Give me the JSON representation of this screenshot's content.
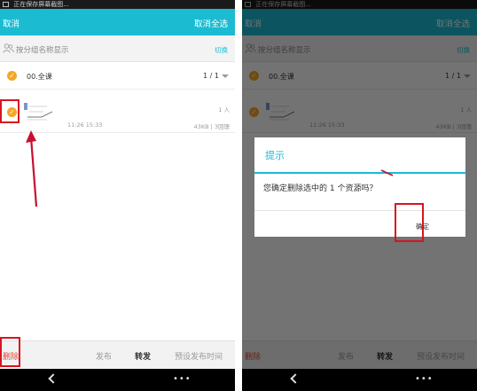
{
  "status_bar": {
    "text": "正在保存屏幕截图..."
  },
  "top_bar": {
    "left_label": "取消",
    "right_label": "取消全选"
  },
  "group_row": {
    "label": "按分组名称显示",
    "switch_label": "切换"
  },
  "all_row": {
    "label": "00.全课",
    "pager": "1 / 1"
  },
  "item": {
    "count": "1 人",
    "time": "11:26 15:33",
    "size": "43KB | 3回馈"
  },
  "bottom_bar": {
    "delete": "删除",
    "publish": "发布",
    "forward": "转发",
    "preset": "预设发布时间"
  },
  "dialog": {
    "title": "提示",
    "message": "您确定删除选中的 1 个资源吗？",
    "confirm": "确定"
  },
  "icons": {
    "check": "check-circle-icon",
    "people": "people-icon",
    "back": "back-icon",
    "more": "more-icon"
  },
  "colors": {
    "accent": "#1bbbd2",
    "highlight": "#d8141f",
    "delete": "#e34a33",
    "check": "#f5a623"
  }
}
